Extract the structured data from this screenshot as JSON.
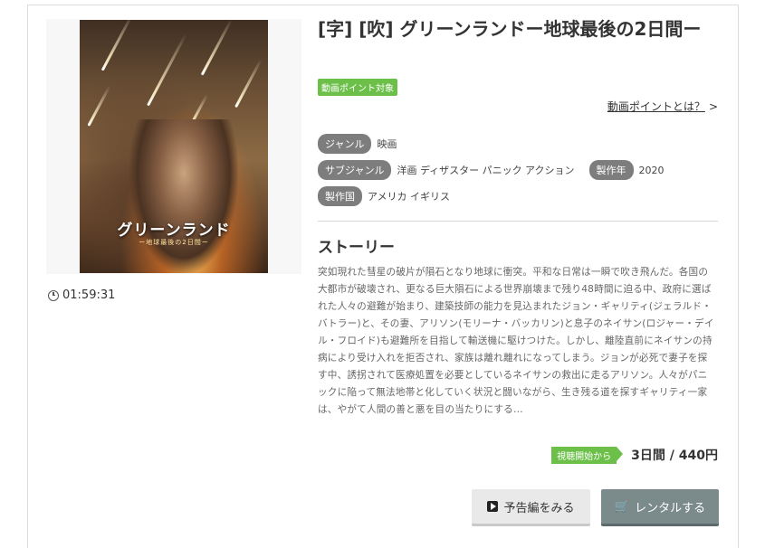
{
  "title": "[字] [吹] グリーンランドー地球最後の2日間ー",
  "badge_point": "動画ポイント対象",
  "point_link": {
    "label": "動画ポイントとは？",
    "arrow": ">"
  },
  "poster": {
    "title": "グリーンランド",
    "subtitle": "ー地球最後の2日間ー"
  },
  "duration": "01:59:31",
  "meta": {
    "genre": {
      "label": "ジャンル",
      "value": "映画"
    },
    "subgenre": {
      "label": "サブジャンル",
      "value": "洋画 ディザスター パニック アクション"
    },
    "year": {
      "label": "製作年",
      "value": "2020"
    },
    "country": {
      "label": "製作国",
      "value": "アメリカ イギリス"
    }
  },
  "story": {
    "heading": "ストーリー",
    "text": "突如現れた彗星の破片が隕石となり地球に衝突。平和な日常は一瞬で吹き飛んだ。各国の大都市が破壊され、更なる巨大隕石による世界崩壊まで残り48時間に迫る中、政府に選ばれた人々の避難が始まり、建築技師の能力を見込まれたジョン・ギャリティ(ジェラルド・バトラー)と、その妻、アリソン(モリーナ・バッカリン)と息子のネイサン(ロジャー・デイル・フロイド)も避難所を目指して輸送機に駆けつけた。しかし、離陸直前にネイサンの持病により受け入れを拒否され、家族は離れ離れになってしまう。ジョンが必死で妻子を探す中、誘拐されて医療処置を必要としているネイサンの救出に走るアリソン。人々がパニックに陥って無法地帯と化していく状況と闘いながら、生き残る道を探すギャリティ一家は、やがて人間の善と悪を目の当たりにする…"
  },
  "pricing": {
    "start_label": "視聴開始から",
    "price": "3日間 / 440円"
  },
  "buttons": {
    "trailer": "予告編をみる",
    "rent": "レンタルする"
  },
  "colors": {
    "accent_green": "#6cc04a",
    "tag_gray": "#7d7d7d",
    "rent_button": "#7b8a8b"
  }
}
